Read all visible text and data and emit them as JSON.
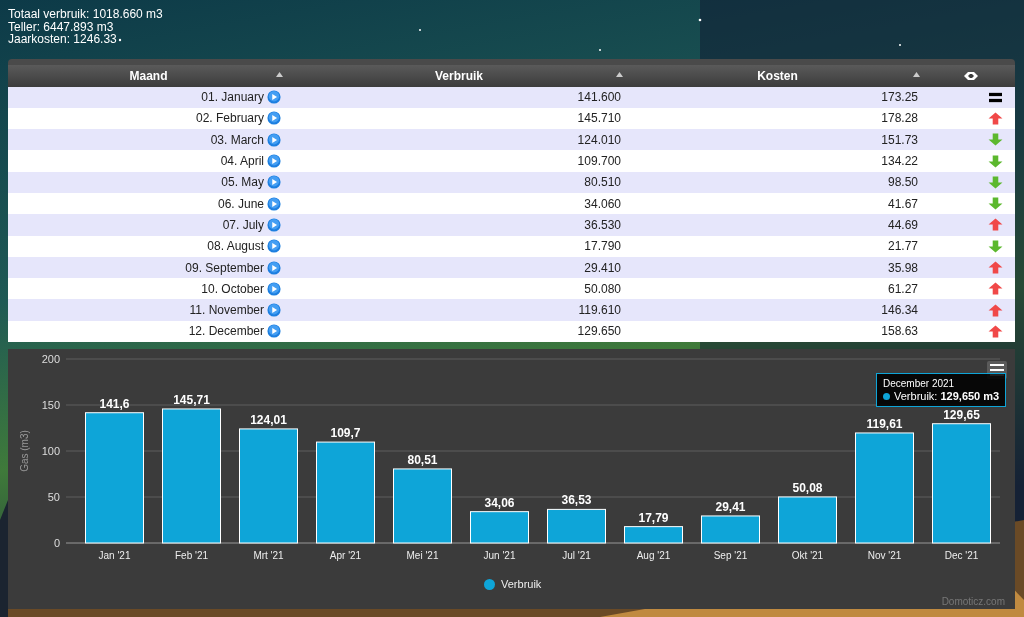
{
  "summary": [
    "Totaal verbruik: 1018.660 m3",
    "Teller: 6447.893 m3",
    "Jaarkosten: 1246.33"
  ],
  "table": {
    "columns": [
      "Maand",
      "Verbruik",
      "Kosten"
    ],
    "rows": [
      {
        "month": "01. January",
        "usage": "141.600",
        "cost": "173.25",
        "kind": "equal"
      },
      {
        "month": "02. February",
        "usage": "145.710",
        "cost": "178.28",
        "kind": "up"
      },
      {
        "month": "03. March",
        "usage": "124.010",
        "cost": "151.73",
        "kind": "down"
      },
      {
        "month": "04. April",
        "usage": "109.700",
        "cost": "134.22",
        "kind": "down"
      },
      {
        "month": "05. May",
        "usage": "80.510",
        "cost": "98.50",
        "kind": "down"
      },
      {
        "month": "06. June",
        "usage": "34.060",
        "cost": "41.67",
        "kind": "down"
      },
      {
        "month": "07. July",
        "usage": "36.530",
        "cost": "44.69",
        "kind": "up"
      },
      {
        "month": "08. August",
        "usage": "17.790",
        "cost": "21.77",
        "kind": "down"
      },
      {
        "month": "09. September",
        "usage": "29.410",
        "cost": "35.98",
        "kind": "up"
      },
      {
        "month": "10. October",
        "usage": "50.080",
        "cost": "61.27",
        "kind": "up"
      },
      {
        "month": "11. November",
        "usage": "119.610",
        "cost": "146.34",
        "kind": "up"
      },
      {
        "month": "12. December",
        "usage": "129.650",
        "cost": "158.63",
        "kind": "up"
      }
    ]
  },
  "chart": {
    "chart_data": {
      "type": "bar",
      "ylabel": "Gas (m3)",
      "categories": [
        "Jan '21",
        "Feb '21",
        "Mrt '21",
        "Apr '21",
        "Mei '21",
        "Jun '21",
        "Jul '21",
        "Aug '21",
        "Sep '21",
        "Okt '21",
        "Nov '21",
        "Dec '21"
      ],
      "series": [
        {
          "name": "Verbruik",
          "color": "#0ea5d8",
          "values": [
            141.6,
            145.71,
            124.01,
            109.7,
            80.51,
            34.06,
            36.53,
            17.79,
            29.41,
            50.08,
            119.61,
            129.65
          ]
        }
      ],
      "value_labels": [
        "141,6",
        "145,71",
        "124,01",
        "109,7",
        "80,51",
        "34,06",
        "36,53",
        "17,79",
        "29,41",
        "50,08",
        "119,61",
        "129,65"
      ],
      "ylim": [
        0,
        200
      ],
      "yticks": [
        0,
        50,
        100,
        150,
        200
      ],
      "grid": true
    },
    "tooltip": {
      "title": "December 2021",
      "text": "Verbruik: **129,650 m3**"
    },
    "credit": "Domoticz.com"
  }
}
